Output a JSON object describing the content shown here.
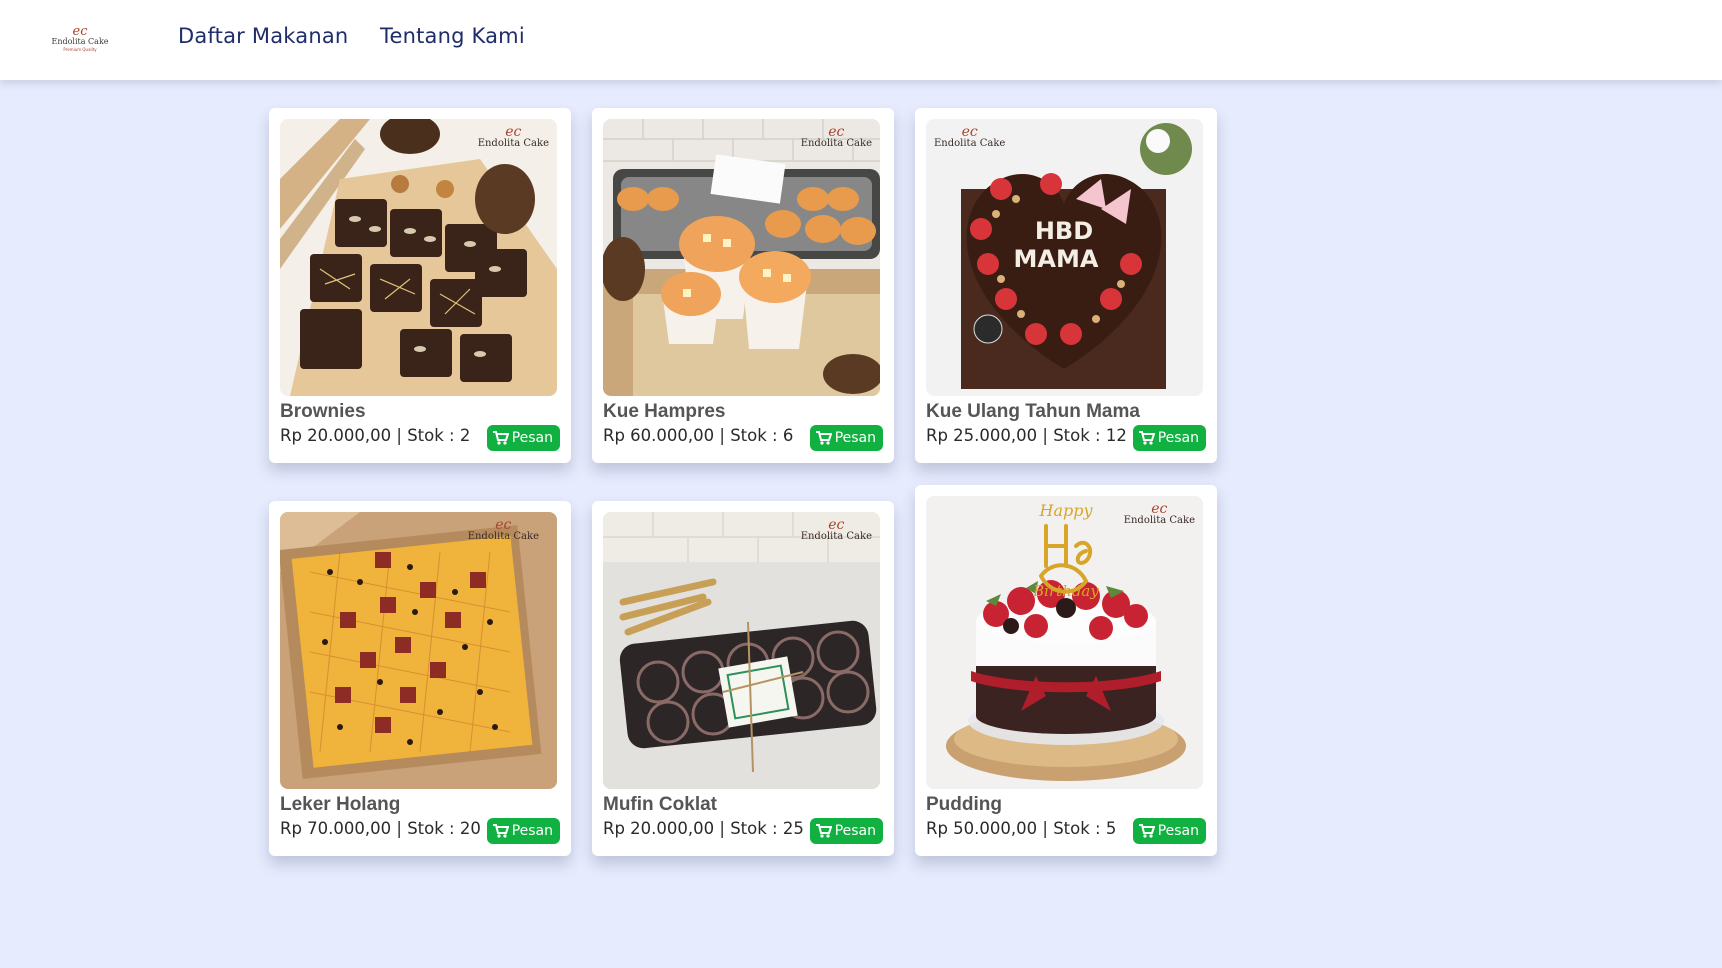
{
  "brand": {
    "mark": "ec",
    "name": "Endolita Cake",
    "tagline": "Premium Quality"
  },
  "nav": [
    {
      "label": "Daftar Makanan"
    },
    {
      "label": "Tentang Kami"
    }
  ],
  "order_button_label": "Pesan",
  "products": [
    {
      "name": "Brownies",
      "info": "Rp 20.000,00 | Stok : 2",
      "price": "Rp 20.000,00",
      "stock": 2
    },
    {
      "name": "Kue Hampres",
      "info": "Rp 60.000,00 | Stok : 6",
      "price": "Rp 60.000,00",
      "stock": 6
    },
    {
      "name": "Kue Ulang Tahun Mama",
      "info": "Rp 25.000,00 | Stok : 12",
      "price": "Rp 25.000,00",
      "stock": 12
    },
    {
      "name": "Leker Holang",
      "info": "Rp 70.000,00 | Stok : 20",
      "price": "Rp 70.000,00",
      "stock": 20
    },
    {
      "name": "Mufin Coklat",
      "info": "Rp 20.000,00 | Stok : 25",
      "price": "Rp 20.000,00",
      "stock": 25
    },
    {
      "name": "Pudding",
      "info": "Rp 50.000,00 | Stok : 5",
      "price": "Rp 50.000,00",
      "stock": 5
    }
  ],
  "photo_text": {
    "hbd": "HBD",
    "mama": "MAMA",
    "happy": "Happy",
    "birthday": "Birthday"
  },
  "colors": {
    "background": "#e6ebfd",
    "nav_text": "#1f2d6b",
    "order_button": "#10b140"
  }
}
